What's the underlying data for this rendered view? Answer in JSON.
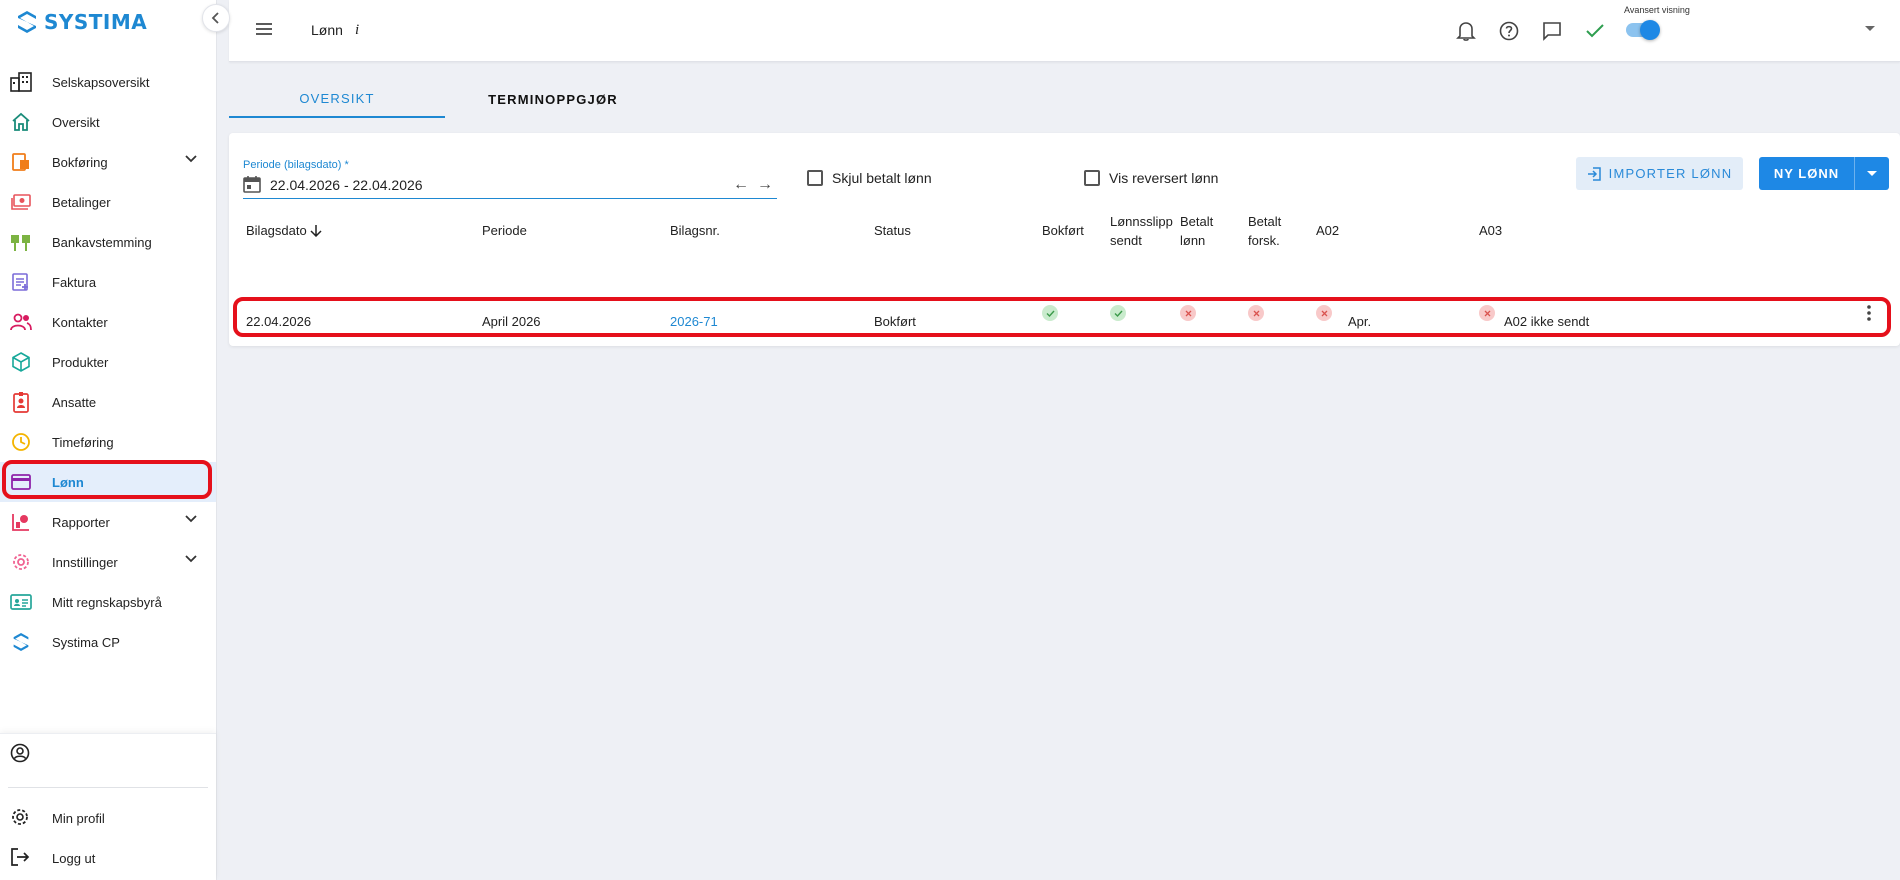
{
  "app": {
    "logo_text": "SYSTIMA",
    "accent": "#1e88d2",
    "highlight": "#e5101b"
  },
  "sidebar": {
    "items": [
      {
        "label": "Selskapsoversikt",
        "icon": "buildings-icon"
      },
      {
        "label": "Oversikt",
        "icon": "home-icon"
      },
      {
        "label": "Bokføring",
        "icon": "bookkeeping-icon",
        "expandable": true
      },
      {
        "label": "Betalinger",
        "icon": "money-icon"
      },
      {
        "label": "Bankavstemming",
        "icon": "bank-reconcile-icon"
      },
      {
        "label": "Faktura",
        "icon": "invoice-icon"
      },
      {
        "label": "Kontakter",
        "icon": "contacts-icon"
      },
      {
        "label": "Produkter",
        "icon": "cube-icon"
      },
      {
        "label": "Ansatte",
        "icon": "badge-icon"
      },
      {
        "label": "Timeføring",
        "icon": "clock-icon"
      },
      {
        "label": "Lønn",
        "icon": "card-icon",
        "active": true
      },
      {
        "label": "Rapporter",
        "icon": "reports-icon",
        "expandable": true
      },
      {
        "label": "Innstillinger",
        "icon": "gear-icon",
        "expandable": true
      },
      {
        "label": "Mitt regnskapsbyrå",
        "icon": "id-card-icon"
      },
      {
        "label": "Systima CP",
        "icon": "systima-logo-icon"
      }
    ],
    "bottom": {
      "min_profil": "Min profil",
      "logg_ut": "Logg ut"
    }
  },
  "topbar": {
    "title": "Lønn",
    "info": "i",
    "advanced_view_label": "Avansert visning",
    "advanced_view_on": true
  },
  "tabs": [
    {
      "label": "OVERSIKT",
      "active": true
    },
    {
      "label": "TERMINOPPGJØR",
      "active": false
    }
  ],
  "filters": {
    "period_label": "Periode (bilagsdato) *",
    "period_value": "22.04.2026 - 22.04.2026",
    "hide_paid_label": "Skjul betalt lønn",
    "show_reversed_label": "Vis reversert lønn"
  },
  "actions": {
    "import_label": "IMPORTER LØNN",
    "new_label": "NY LØNN"
  },
  "table": {
    "columns": [
      "Bilagsdato",
      "Periode",
      "Bilagsnr.",
      "Status",
      "Bokført",
      "Lønnsslipp sendt",
      "Betalt lønn",
      "Betalt forsk.",
      "A02",
      "A03"
    ],
    "col_heads": {
      "bilagsdato": "Bilagsdato",
      "periode": "Periode",
      "bilagsnr": "Bilagsnr.",
      "status": "Status",
      "bokfort": "Bokført",
      "lonnsslipp_l1": "Lønnsslipp",
      "lonnsslipp_l2": "sendt",
      "betalt_lonn_l1": "Betalt",
      "betalt_lonn_l2": "lønn",
      "betalt_forsk_l1": "Betalt",
      "betalt_forsk_l2": "forsk.",
      "a02": "A02",
      "a03": "A03"
    },
    "rows": [
      {
        "bilagsdato": "22.04.2026",
        "periode": "April 2026",
        "bilagsnr": "2026-71",
        "status": "Bokført",
        "bokfort": "ok",
        "lonnsslipp_sendt": "ok",
        "betalt_lonn": "no",
        "betalt_forsk": "no",
        "a02_status": "no",
        "a02_text": "Apr.",
        "a03_status": "no",
        "a03_text": "A02 ikke sendt"
      }
    ]
  }
}
